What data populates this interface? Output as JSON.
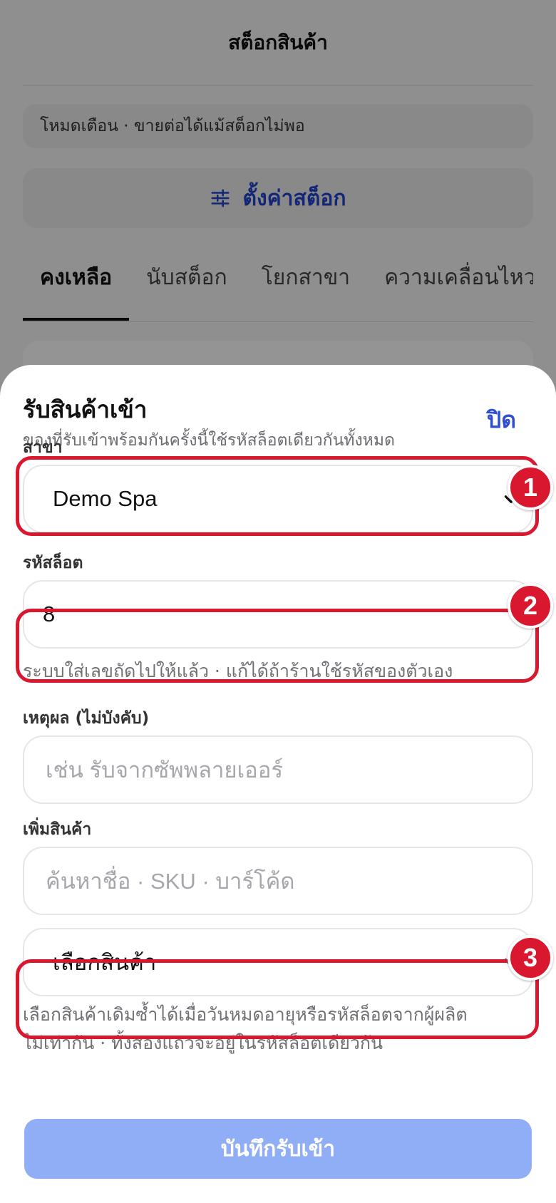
{
  "background": {
    "header_title": "สต็อกสินค้า",
    "mode_chip": "โหมดเตือน · ขายต่อได้แม้สต็อกไม่พอ",
    "settings_button": "ตั้งค่าสต็อก",
    "tabs": [
      "คงเหลือ",
      "นับสต็อก",
      "โยกสาขา",
      "ความเคลื่อนไหว"
    ],
    "active_tab": "คงเหลือ"
  },
  "sheet": {
    "title": "รับสินค้าเข้า",
    "subtitle": "ของที่รับเข้าพร้อมกันครั้งนี้ใช้รหัสล็อตเดียวกันทั้งหมด",
    "close_label": "ปิด",
    "branch": {
      "label": "สาขา",
      "value": "Demo Spa"
    },
    "lot": {
      "label": "รหัสล็อต",
      "value": "8",
      "hint": "ระบบใส่เลขถัดไปให้แล้ว · แก้ได้ถ้าร้านใช้รหัสของตัวเอง"
    },
    "reason": {
      "label": "เหตุผล (ไม่บังคับ)",
      "placeholder": "เช่น รับจากซัพพลายเออร์"
    },
    "add_product": {
      "label": "เพิ่มสินค้า",
      "search_placeholder": "ค้นหาชื่อ · SKU · บาร์โค้ด",
      "select_value": "เลือกสินค้า",
      "hint_line1": "เลือกสินค้าเดิมซ้ำได้เมื่อวันหมดอายุหรือรหัสล็อตจากผู้ผลิต",
      "hint_line2": "ไม่เท่ากัน · ทั้งสองแถวจะอยู่ในรหัสล็อตเดียวกัน"
    },
    "save_label": "บันทึกรับเข้า"
  },
  "annotations": [
    "1",
    "2",
    "3"
  ],
  "colors": {
    "accent": "#2f4fcf",
    "highlight": "#d9172f",
    "save_disabled": "#90aef5"
  }
}
